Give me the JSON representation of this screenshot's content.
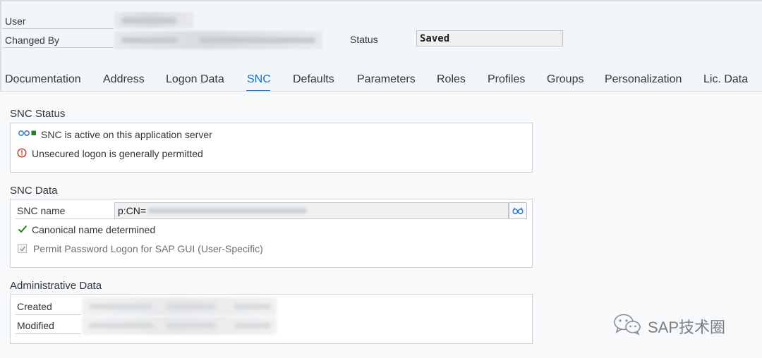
{
  "header": {
    "user_label": "User",
    "changed_by_label": "Changed By",
    "status_label": "Status",
    "status_value": "Saved"
  },
  "tabs": [
    {
      "label": "Documentation",
      "active": false
    },
    {
      "label": "Address",
      "active": false
    },
    {
      "label": "Logon Data",
      "active": false
    },
    {
      "label": "SNC",
      "active": true
    },
    {
      "label": "Defaults",
      "active": false
    },
    {
      "label": "Parameters",
      "active": false
    },
    {
      "label": "Roles",
      "active": false
    },
    {
      "label": "Profiles",
      "active": false
    },
    {
      "label": "Groups",
      "active": false
    },
    {
      "label": "Personalization",
      "active": false
    },
    {
      "label": "Lic. Data",
      "active": false
    }
  ],
  "snc_status": {
    "title": "SNC Status",
    "active_message": "SNC is active on this application server",
    "unsecured_message": "Unsecured logon is generally permitted"
  },
  "snc_data": {
    "title": "SNC Data",
    "name_label": "SNC name",
    "name_value": "p:CN=",
    "canonical_message": "Canonical name determined",
    "permit_password_label": "Permit Password Logon for SAP GUI (User-Specific)",
    "permit_password_checked": true
  },
  "admin": {
    "title": "Administrative Data",
    "created_label": "Created",
    "modified_label": "Modified"
  },
  "watermark": {
    "text": "SAP技术圈"
  },
  "icons": {
    "snc_active": "snc-active-icon",
    "warning": "warning-circle-icon",
    "check": "checkmark-icon",
    "value_help": "glasses-icon",
    "wechat": "wechat-icon"
  },
  "colors": {
    "accent": "#1a6fc2",
    "success": "#2b7c2b",
    "warning": "#c0392b"
  }
}
